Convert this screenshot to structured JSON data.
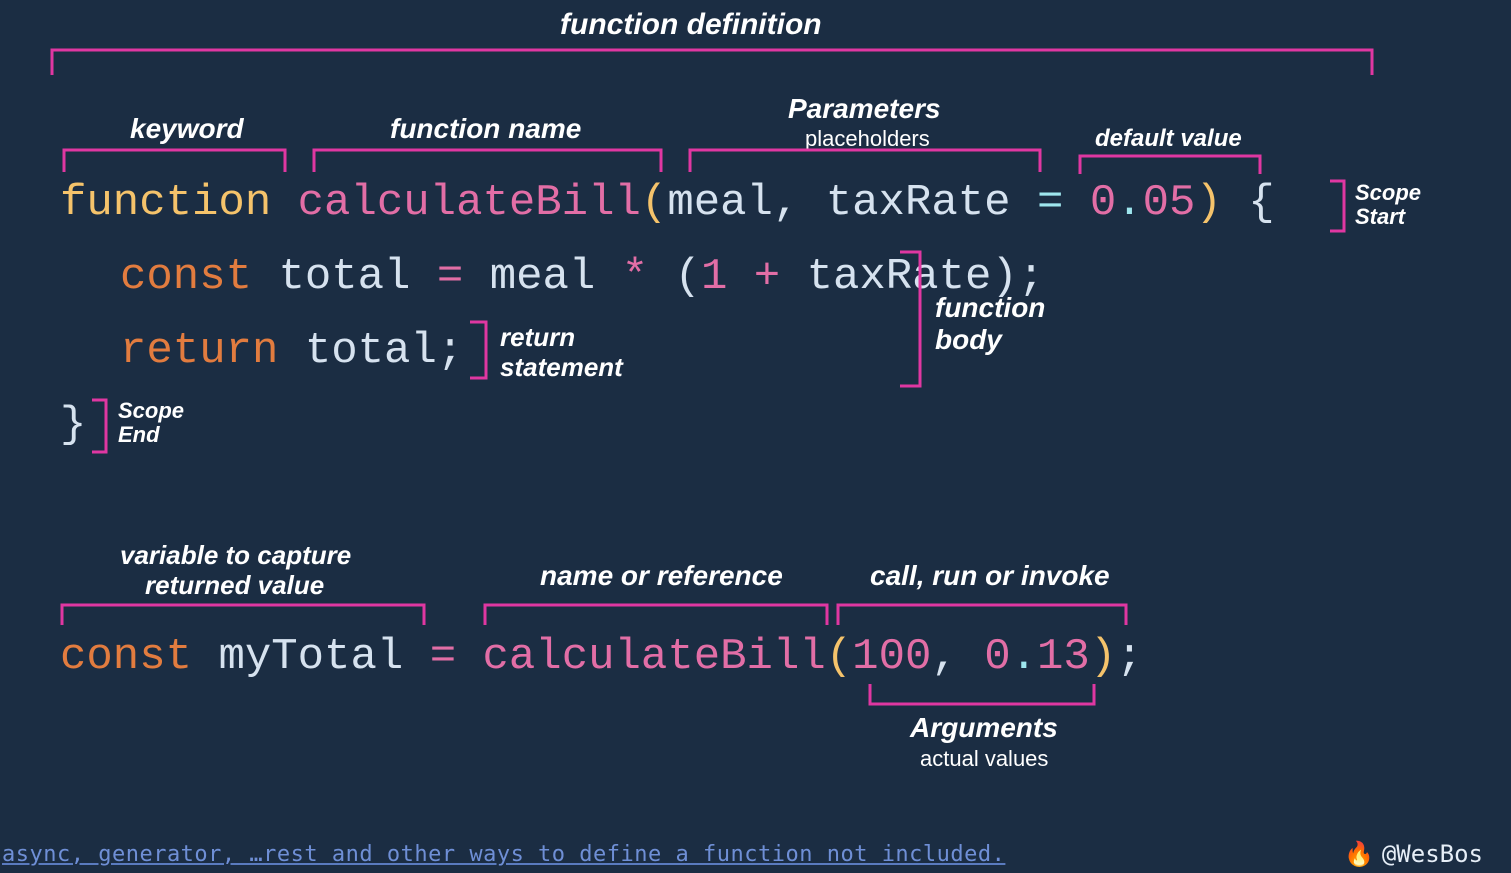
{
  "labels": {
    "functionDefinition": "function definition",
    "keyword": "keyword",
    "functionName": "function name",
    "parameters": "Parameters",
    "parametersSub": "placeholders",
    "defaultValue": "default value",
    "scopeStart1": "Scope",
    "scopeStart2": "Start",
    "functionBody1": "function",
    "functionBody2": "body",
    "returnStatement1": "return",
    "returnStatement2": "statement",
    "scopeEnd1": "Scope",
    "scopeEnd2": "End",
    "varCapture1": "variable to capture",
    "varCapture2": "returned value",
    "nameOrRef": "name or reference",
    "callRunInvoke": "call, run or invoke",
    "arguments": "Arguments",
    "argumentsSub": "actual values"
  },
  "code": {
    "fnKeyword": "function",
    "fnName": "calculateBill",
    "param1": "meal",
    "param2": "taxRate",
    "defaultVal": "0.05",
    "constKw": "const",
    "totalVar": "total",
    "one": "1",
    "returnKw": "return",
    "myTotalVar": "myTotal",
    "arg1": "100",
    "arg2": "0.13"
  },
  "footer": {
    "note": "async, generator, …rest and other ways to define a function not included.",
    "handle": "@WesBos",
    "emoji": "🔥"
  },
  "colors": {
    "bg": "#1b2d43",
    "accent": "#e037a2",
    "keywordYellow": "#f5c36b",
    "nameMagenta": "#e26ea6",
    "constOrange": "#e27c3f",
    "cyan": "#9ee6ee"
  }
}
